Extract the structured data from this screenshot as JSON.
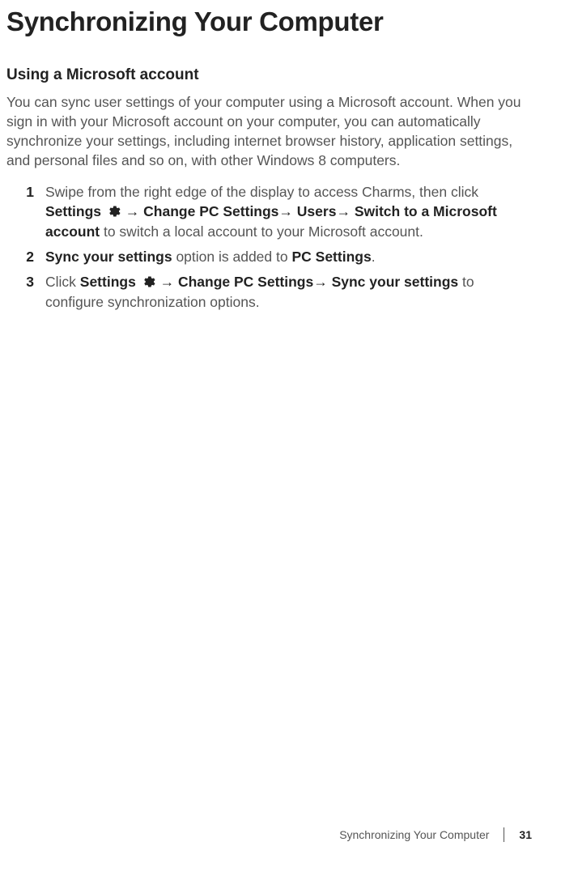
{
  "title": "Synchronizing Your Computer",
  "section_title": "Using a Microsoft account",
  "intro": "You can sync user settings of your computer using a Microsoft account. When you sign in with your Microsoft account on your computer, you can automatically synchronize your settings, including internet browser history, application settings, and personal files and so on, with other Windows 8 computers.",
  "steps": [
    {
      "num": "1",
      "pre": "Swipe from the right edge of the display to access Charms, then click ",
      "settings": "Settings",
      "arrow1": " → ",
      "part1": "Change PC Settings",
      "arrow2": "→ ",
      "part2": "Users",
      "arrow3": "→ ",
      "part3": "Switch to a Microsoft account",
      "post": " to switch a local account to your Microsoft account."
    },
    {
      "num": "2",
      "pre": "",
      "b1": "Sync your settings",
      "mid": " option is added to ",
      "b2": "PC Settings",
      "post": "."
    },
    {
      "num": "3",
      "pre": "Click ",
      "settings": "Settings",
      "arrow1": " → ",
      "part1": "Change PC Settings",
      "arrow2": "→  ",
      "part2": "Sync your settings",
      "post": " to configure synchronization options."
    }
  ],
  "footer": {
    "label": "Synchronizing Your Computer",
    "page": "31"
  }
}
